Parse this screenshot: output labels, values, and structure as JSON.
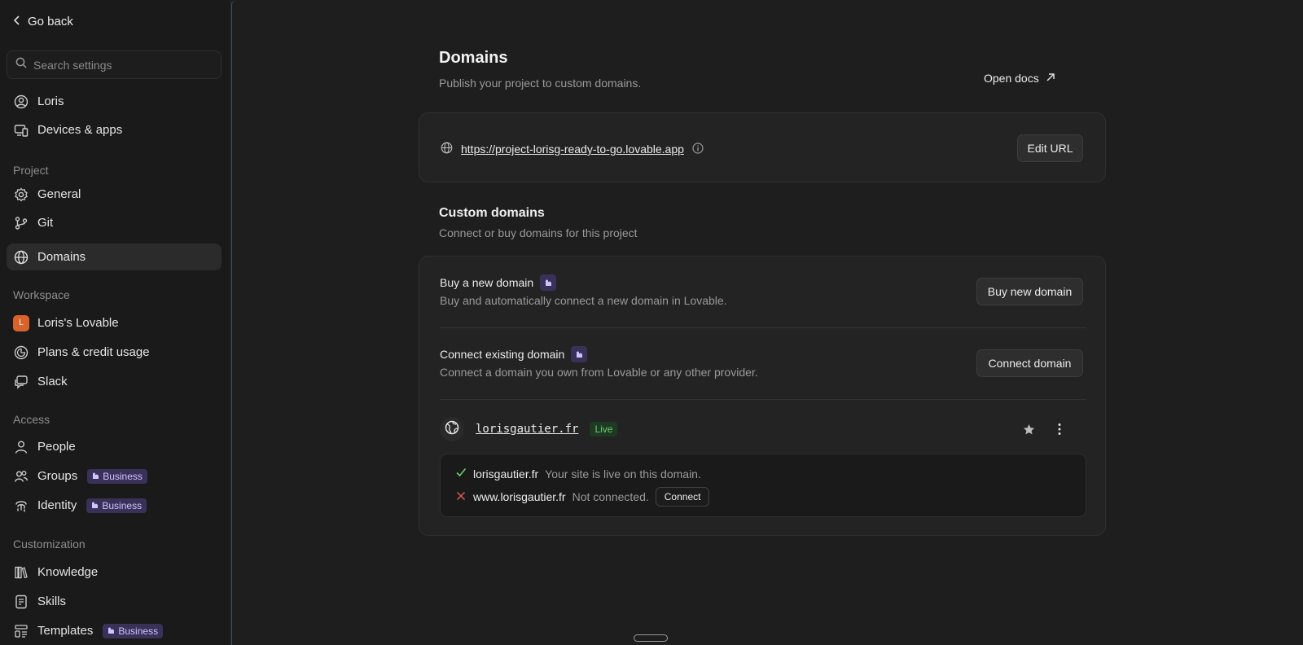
{
  "sidebar": {
    "go_back": "Go back",
    "search_placeholder": "Search settings",
    "user": "Loris",
    "devices": "Devices & apps",
    "sections": {
      "project": "Project",
      "workspace": "Workspace",
      "access": "Access",
      "customization": "Customization"
    },
    "project_items": [
      "General",
      "Git",
      "Domains"
    ],
    "workspace_items": [
      "Loris's Lovable",
      "Plans & credit usage",
      "Slack"
    ],
    "workspace_avatar_letter": "L",
    "access_items": [
      "People",
      "Groups",
      "Identity"
    ],
    "customization_items": [
      "Knowledge",
      "Skills",
      "Templates"
    ],
    "business_badge": "Business",
    "active_item": "Domains"
  },
  "main": {
    "title": "Domains",
    "subtitle": "Publish your project to custom domains.",
    "open_docs": "Open docs",
    "project_url": "https://project-lorisg-ready-to-go.lovable.app",
    "edit_url": "Edit URL",
    "custom_domains_title": "Custom domains",
    "custom_domains_sub": "Connect or buy domains for this project",
    "buy": {
      "title": "Buy a new domain",
      "desc": "Buy and automatically connect a new domain in Lovable.",
      "button": "Buy new domain"
    },
    "connect": {
      "title": "Connect existing domain",
      "desc": "Connect a domain you own from Lovable or any other provider.",
      "button": "Connect domain"
    },
    "domain": {
      "name": "lorisgautier.fr",
      "status": "Live",
      "entries": [
        {
          "host": "lorisgautier.fr",
          "note": "Your site is live on this domain.",
          "ok": true
        },
        {
          "host": "www.lorisgautier.fr",
          "note": "Not connected.",
          "ok": false,
          "action": "Connect"
        }
      ]
    }
  },
  "colors": {
    "accent_purple": "#3a3158",
    "live_green": "#6bcb6f",
    "error_red": "#e05a4f",
    "avatar_orange": "#d9632c"
  }
}
